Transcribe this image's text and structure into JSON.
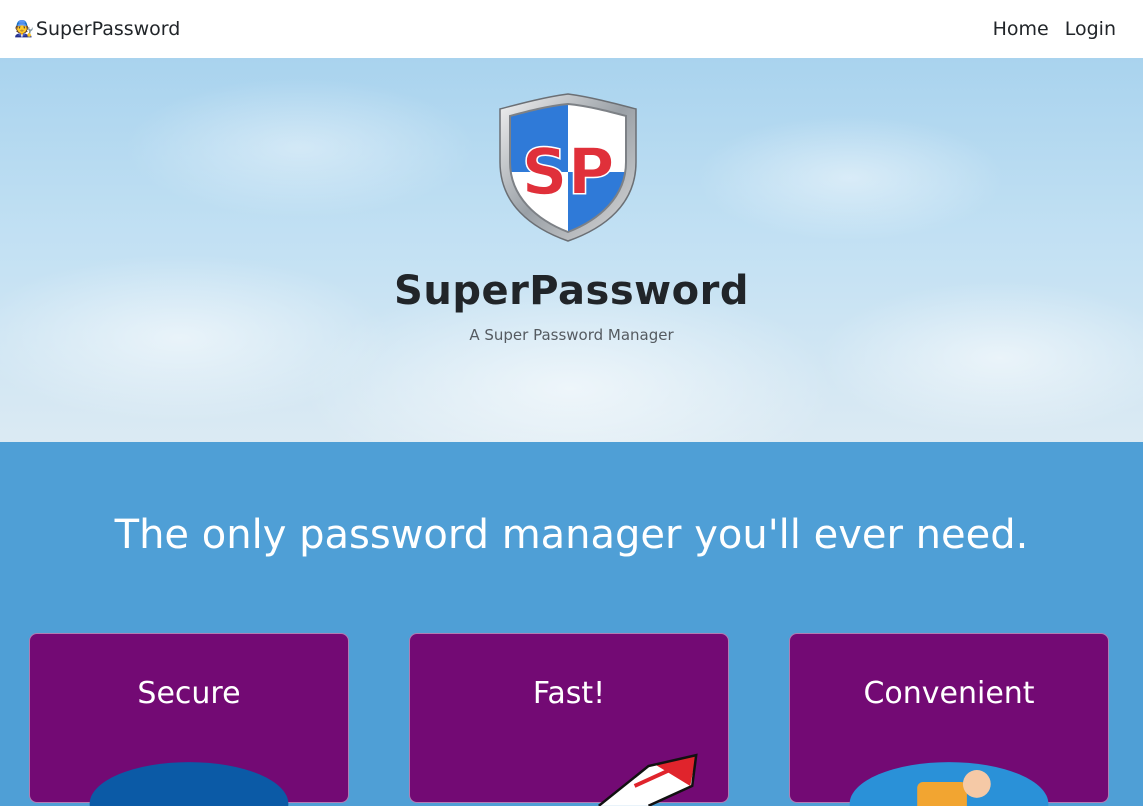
{
  "navbar": {
    "brand_icon": "🧑‍🔧",
    "brand_name": "SuperPassword",
    "links": [
      "Home",
      "Login"
    ]
  },
  "hero": {
    "logo_text": "SP",
    "title": "SuperPassword",
    "subtitle": "A Super Password Manager"
  },
  "tagline": "The only password manager you'll ever need.",
  "features": [
    {
      "title": "Secure",
      "icon": "lock-icon"
    },
    {
      "title": "Fast!",
      "icon": "rocket-icon"
    },
    {
      "title": "Convenient",
      "icon": "hand-icon"
    }
  ],
  "colors": {
    "navbar": "#ffffff",
    "page_blue": "#4f9fd6",
    "card_purple": "#730a74",
    "shield_red": "#e0303a",
    "shield_blue": "#2f7ad8"
  }
}
